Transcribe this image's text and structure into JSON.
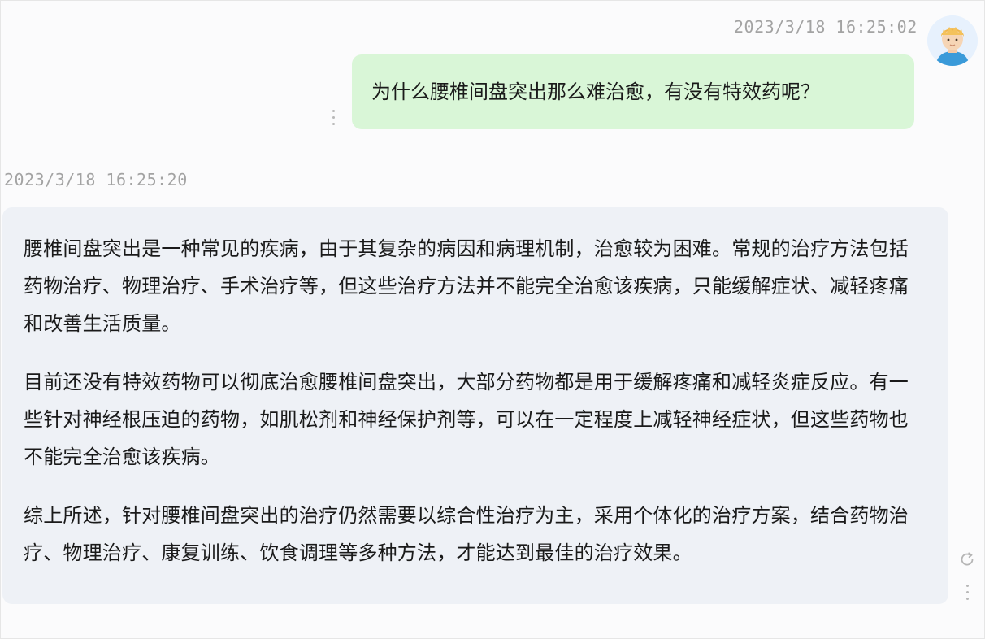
{
  "messages": {
    "user": {
      "timestamp": "2023/3/18 16:25:02",
      "text": "为什么腰椎间盘突出那么难治愈，有没有特效药呢？"
    },
    "assistant": {
      "timestamp": "2023/3/18 16:25:20",
      "paragraphs": [
        "腰椎间盘突出是一种常见的疾病，由于其复杂的病因和病理机制，治愈较为困难。常规的治疗方法包括药物治疗、物理治疗、手术治疗等，但这些治疗方法并不能完全治愈该疾病，只能缓解症状、减轻疼痛和改善生活质量。",
        "目前还没有特效药物可以彻底治愈腰椎间盘突出，大部分药物都是用于缓解疼痛和减轻炎症反应。有一些针对神经根压迫的药物，如肌松剂和神经保护剂等，可以在一定程度上减轻神经症状，但这些药物也不能完全治愈该疾病。",
        "综上所述，针对腰椎间盘突出的治疗仍然需要以综合性治疗为主，采用个体化的治疗方案，结合药物治疗、物理治疗、康复训练、饮食调理等多种方法，才能达到最佳的治疗效果。"
      ]
    }
  },
  "icons": {
    "avatar": "user-avatar-cartoon",
    "more_user": "more-vertical-icon",
    "more_bot": "more-vertical-icon",
    "regenerate": "refresh-icon"
  },
  "colors": {
    "user_bubble": "#d9f6d7",
    "bot_bubble": "#eef1f6",
    "timestamp": "#a3a3a3"
  }
}
